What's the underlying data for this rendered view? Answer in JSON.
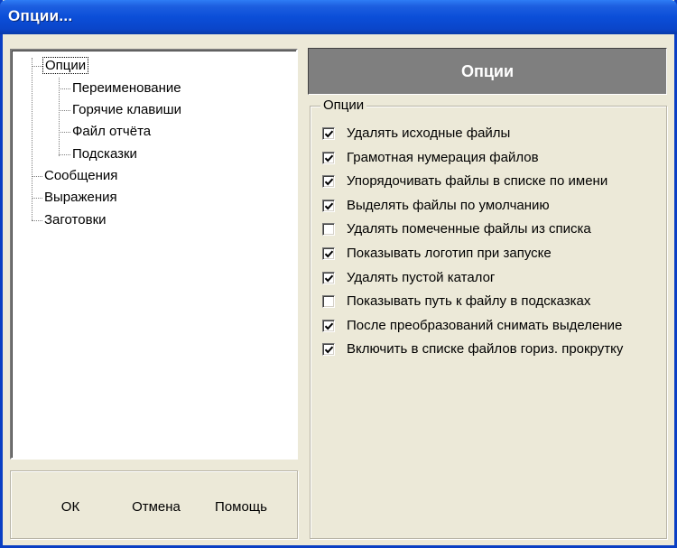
{
  "window": {
    "title": "Опции..."
  },
  "tree": {
    "items": [
      {
        "label": "Опции",
        "selected": true
      },
      {
        "label": "Переименование"
      },
      {
        "label": "Горячие клавиши"
      },
      {
        "label": "Файл отчёта"
      },
      {
        "label": "Подсказки"
      },
      {
        "label": "Сообщения"
      },
      {
        "label": "Выражения"
      },
      {
        "label": "Заготовки"
      }
    ]
  },
  "buttons": {
    "ok": "ОК",
    "cancel": "Отмена",
    "help": "Помощь"
  },
  "panel": {
    "header": "Опции",
    "group_title": "Опции",
    "options": [
      {
        "label": "Удалять исходные файлы",
        "checked": true
      },
      {
        "label": "Грамотная нумерация файлов",
        "checked": true
      },
      {
        "label": "Упорядочивать файлы в списке по имени",
        "checked": true
      },
      {
        "label": "Выделять файлы по умолчанию",
        "checked": true
      },
      {
        "label": "Удалять помеченные файлы из списка",
        "checked": false
      },
      {
        "label": "Показывать логотип при запуске",
        "checked": true
      },
      {
        "label": "Удалять пустой каталог",
        "checked": true
      },
      {
        "label": "Показывать путь к файлу в подсказках",
        "checked": false
      },
      {
        "label": "После преобразований снимать выделение",
        "checked": true
      },
      {
        "label": "Включить в списке файлов гориз. прокрутку",
        "checked": true
      }
    ]
  }
}
